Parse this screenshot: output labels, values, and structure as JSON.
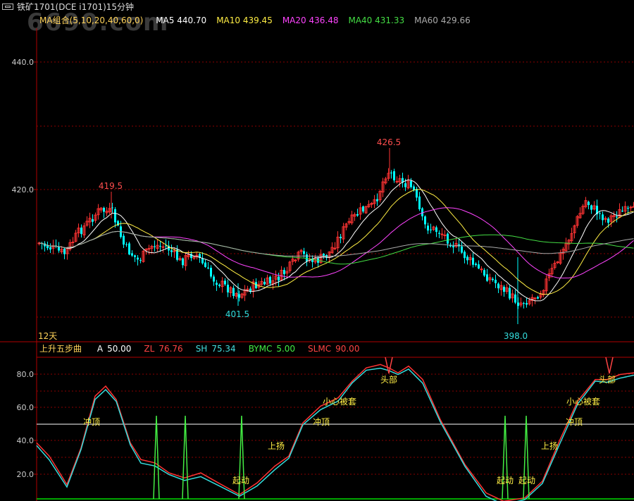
{
  "window": {
    "title": "铁矿1701(DCE i1701)15分钟",
    "watermark": "6690.com"
  },
  "main_panel": {
    "ma_legend": {
      "name": "MA组合(5,10,20,40,60,0)",
      "items": [
        {
          "label": "MA5 440.70",
          "color": "#ffffff"
        },
        {
          "label": "MA10 439.45",
          "color": "#ffee44"
        },
        {
          "label": "MA20 436.48",
          "color": "#ff44ff"
        },
        {
          "label": "MA40 431.33",
          "color": "#44dd44"
        },
        {
          "label": "MA60 429.66",
          "color": "#aaaaaa"
        }
      ]
    },
    "y_ticks": [
      "440.0",
      "420.0"
    ],
    "peak_labels": [
      {
        "text": "419.5",
        "color": "#ff4d4d"
      },
      {
        "text": "401.5",
        "color": "#33dddd"
      },
      {
        "text": "426.5",
        "color": "#ff4d4d"
      },
      {
        "text": "398.0",
        "color": "#33dddd"
      }
    ],
    "period_label": "12天"
  },
  "indicator_panel": {
    "name": "上升五步曲",
    "values": [
      {
        "key": "A",
        "value": "50.00",
        "color": "#ffffff"
      },
      {
        "key": "ZL",
        "value": "76.76",
        "color": "#ff4444"
      },
      {
        "key": "SH",
        "value": "75.34",
        "color": "#44dddd"
      },
      {
        "key": "BYMC",
        "value": "5.00",
        "color": "#44ee44"
      },
      {
        "key": "SLMC",
        "value": "90.00",
        "color": "#ff4444"
      }
    ],
    "y_ticks": [
      "80.0",
      "60.0",
      "40.0",
      "20.0"
    ],
    "annotations": [
      "冲顶",
      "起动",
      "上扬",
      "冲顶",
      "小心被套",
      "头部",
      "起动",
      "起动",
      "上扬",
      "冲顶",
      "小心被套",
      "头部"
    ]
  },
  "colors": {
    "up": "#ff3333",
    "down": "#00ffff",
    "grid": "#8b0000",
    "axis": "#b00000",
    "annotation": "#ffee44"
  }
}
